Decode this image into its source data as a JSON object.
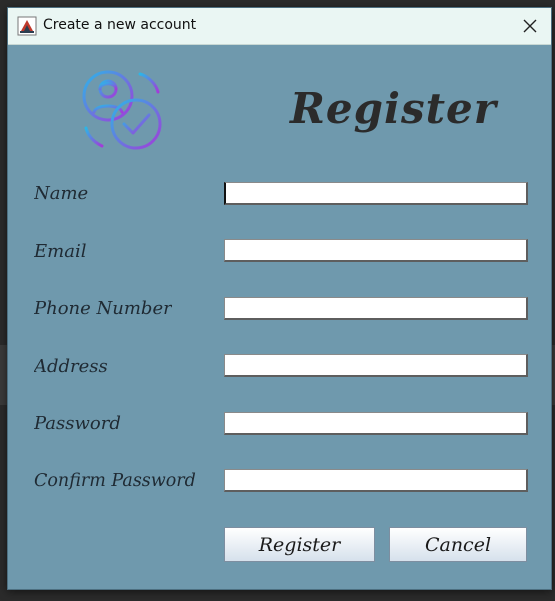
{
  "window": {
    "title": "Create a new account"
  },
  "heading": "Register",
  "fields": [
    {
      "label": "Name",
      "value": "",
      "placeholder": ""
    },
    {
      "label": "Email",
      "value": "",
      "placeholder": ""
    },
    {
      "label": "Phone Number",
      "value": "",
      "placeholder": ""
    },
    {
      "label": "Address",
      "value": "",
      "placeholder": ""
    },
    {
      "label": "Password",
      "value": "",
      "placeholder": ""
    },
    {
      "label": "Confirm Password",
      "value": "",
      "placeholder": ""
    }
  ],
  "buttons": {
    "register": "Register",
    "cancel": "Cancel"
  },
  "icons": {
    "app": "java-app-icon",
    "close": "close-icon",
    "logo": "user-verified-icon"
  },
  "colors": {
    "window_bg": "#6f99ad",
    "titlebar_bg": "#eaf6f3",
    "logo_gradient_start": "#2bb6e8",
    "logo_gradient_end": "#a33bd9"
  }
}
